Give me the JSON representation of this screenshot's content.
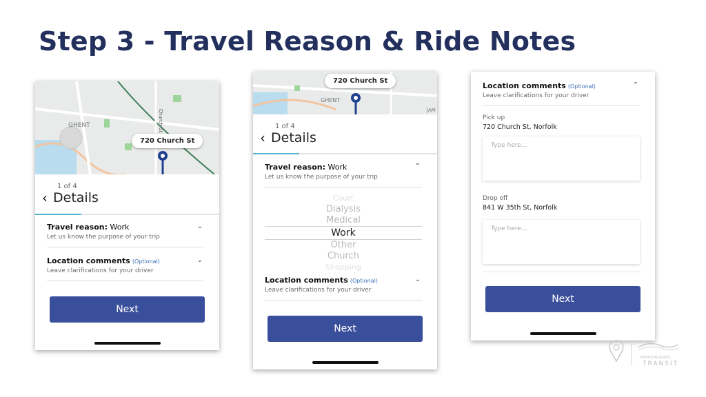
{
  "slide": {
    "title": "Step 3 - Travel Reason & Ride Notes"
  },
  "map": {
    "area_label": "GHENT",
    "street_label": "Church St",
    "address_tag": "720 Church St",
    "edge_label": "JAM"
  },
  "screens": [
    {
      "step_count": "1 of 4",
      "header_title": "Details",
      "rows": [
        {
          "title_bold": "Travel reason:",
          "title_value": " Work",
          "subtitle": "Let us know the purpose of your trip"
        },
        {
          "title_bold": "Location comments",
          "optional": "(Optional)",
          "subtitle": "Leave clarifications for your driver"
        }
      ],
      "button": "Next"
    },
    {
      "step_count": "1 of 4",
      "header_title": "Details",
      "rows": [
        {
          "title_bold": "Travel reason:",
          "title_value": " Work",
          "subtitle": "Let us know the purpose of your trip"
        },
        {
          "title_bold": "Location comments",
          "optional": "(Optional)",
          "subtitle": "Leave clarifications for your driver"
        }
      ],
      "picker_options": [
        "Court",
        "Dialysis",
        "Medical",
        "Work",
        "Other",
        "Church",
        "Shopping"
      ],
      "picker_selected": "Work",
      "button": "Next"
    },
    {
      "rows": [
        {
          "title_bold": "Location comments",
          "optional": "(Optional)",
          "subtitle": "Leave clarifications for your driver"
        }
      ],
      "pickup_label": "Pick up",
      "pickup_address": "720 Church St, Norfolk",
      "dropoff_label": "Drop off",
      "dropoff_address": "841 W 35th St, Norfolk",
      "placeholder": "Type here...",
      "button": "Next"
    }
  ],
  "logo": {
    "text": "TRANSIT",
    "small_text": "HAMPTON ROADS"
  },
  "colors": {
    "title": "#23305e",
    "button": "#3a4f9c",
    "route": "#1f3f8f",
    "map_bg": "#e8ebe9"
  },
  "icons": {
    "back": "chevron-left-icon",
    "expand": "chevron-down-icon",
    "collapse": "chevron-up-icon",
    "pin": "map-pin-icon"
  }
}
